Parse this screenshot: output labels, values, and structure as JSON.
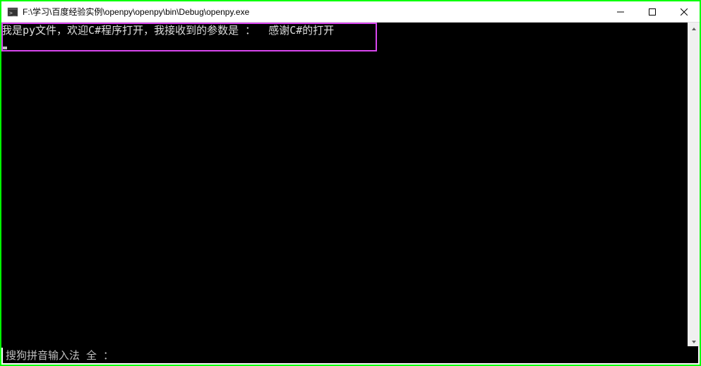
{
  "window": {
    "title": "F:\\学习\\百度经验实例\\openpy\\openpy\\bin\\Debug\\openpy.exe"
  },
  "console": {
    "output_line": "我是py文件，欢迎C#程序打开，我接收到的参数是 ：  感谢C#的打开"
  },
  "ime": {
    "status": "搜狗拼音输入法 全 ："
  }
}
